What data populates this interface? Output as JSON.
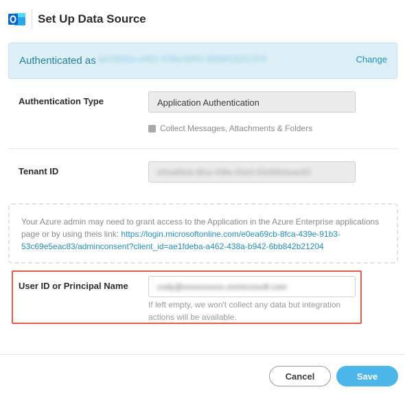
{
  "header": {
    "title": "Set Up Data Source",
    "logo_icon": "outlook-icon"
  },
  "auth": {
    "label": "Authenticated as",
    "account_id": "ae1fdeba-a462-438a-b942-6bb842b21204",
    "change_label": "Change"
  },
  "auth_type": {
    "label": "Authentication Type",
    "selected": "Application Authentication",
    "checkbox_label": "Collect Messages, Attachments & Folders"
  },
  "tenant": {
    "label": "Tenant ID",
    "value": "e0ea69cb-8fca-439e-91b3-53c69e5eac83"
  },
  "info": {
    "text": "Your Azure admin may need to grant access to the Application in the Azure Enterprise applications page or by using theis link: ",
    "link": "https://login.microsoftonline.com/e0ea69cb-8fca-439e-91b3-53c69e5eac83/adminconsent?client_id=ae1fdeba-a462-438a-b942-6bb842b21204"
  },
  "user": {
    "label": "User ID or Principal Name",
    "value": "cody@xxxxxxxxxx.onmicrosoft.com",
    "helper": "If left empty, we won't collect any data but integration actions will be available."
  },
  "footer": {
    "cancel_label": "Cancel",
    "save_label": "Save"
  },
  "colors": {
    "accent": "#4db6e8",
    "banner_bg": "#ddf0f8",
    "highlight_border": "#e55a4a"
  }
}
